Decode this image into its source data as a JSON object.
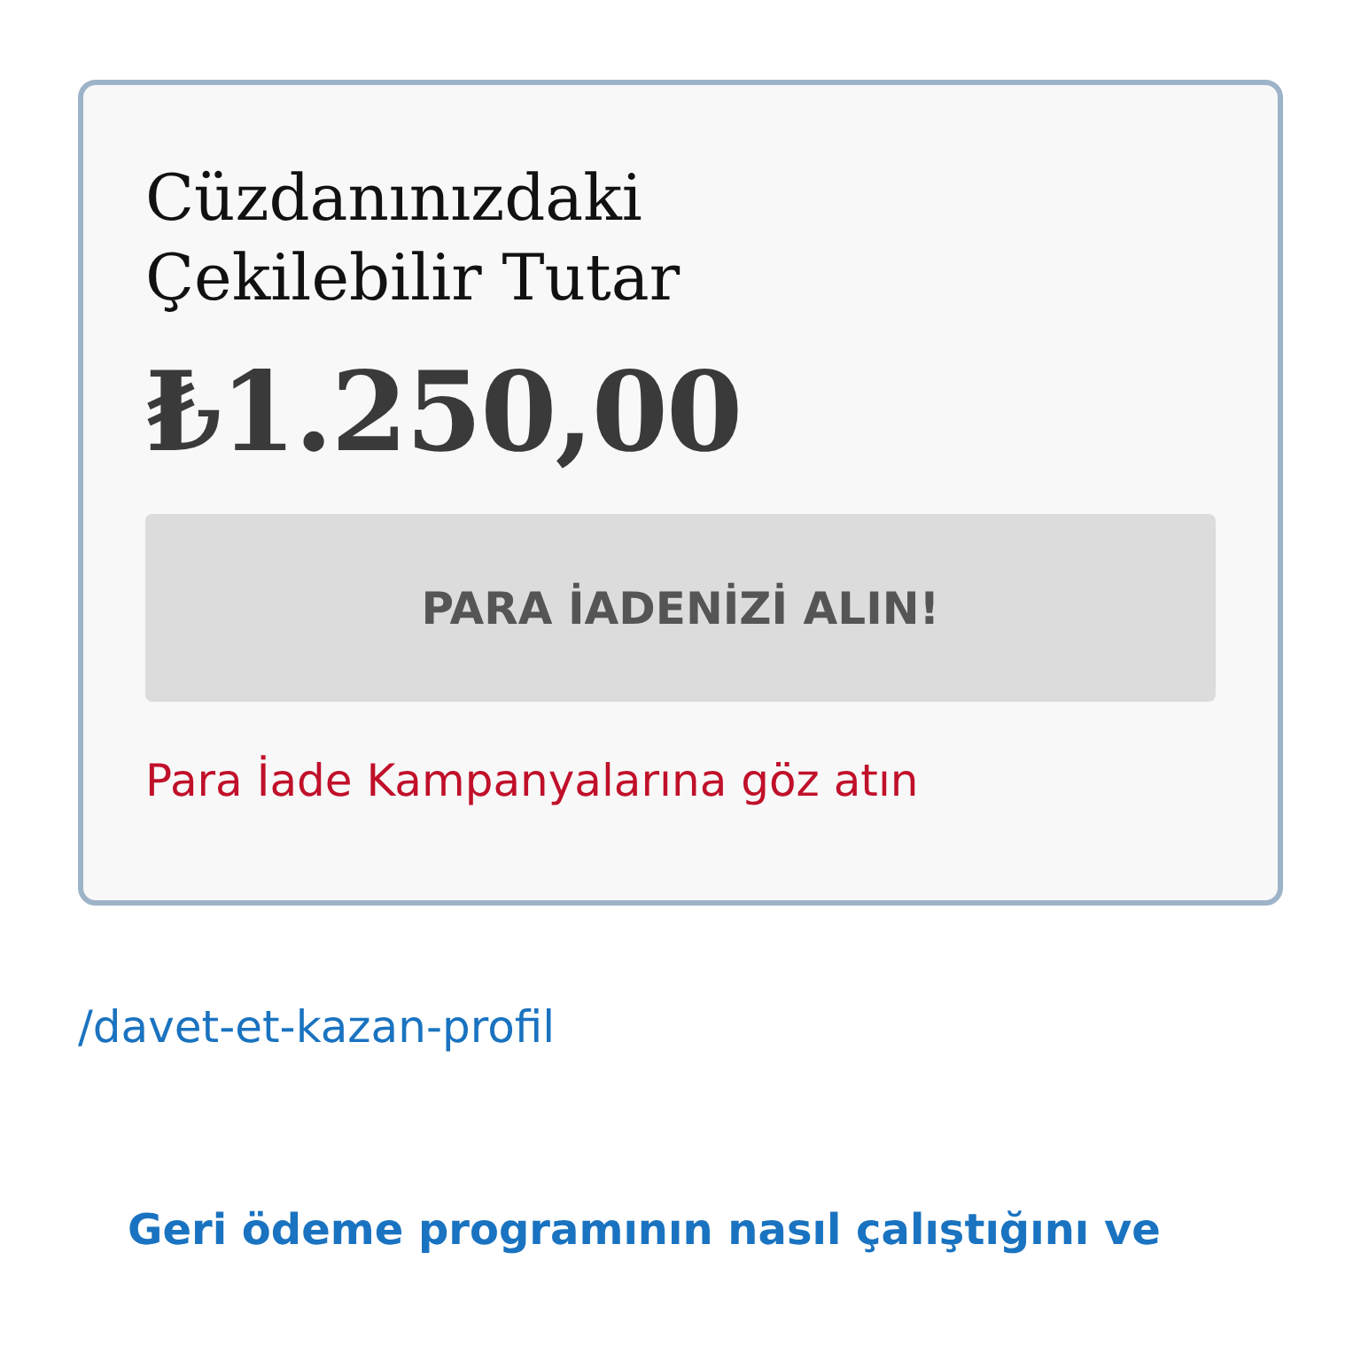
{
  "wallet_card": {
    "title": "Cüzdanınızdaki Çekilebilir Tutar",
    "amount": "₺1.250,00",
    "button": {
      "label": "PARA İADENİZİ ALIN!",
      "disabled": true
    },
    "campaign_link": "Para İade Kampanyalarına göz atın"
  },
  "path_link": "/davet-et-kazan-profil",
  "info_link": "Geri ödeme programının nasıl çalıştığını ve"
}
